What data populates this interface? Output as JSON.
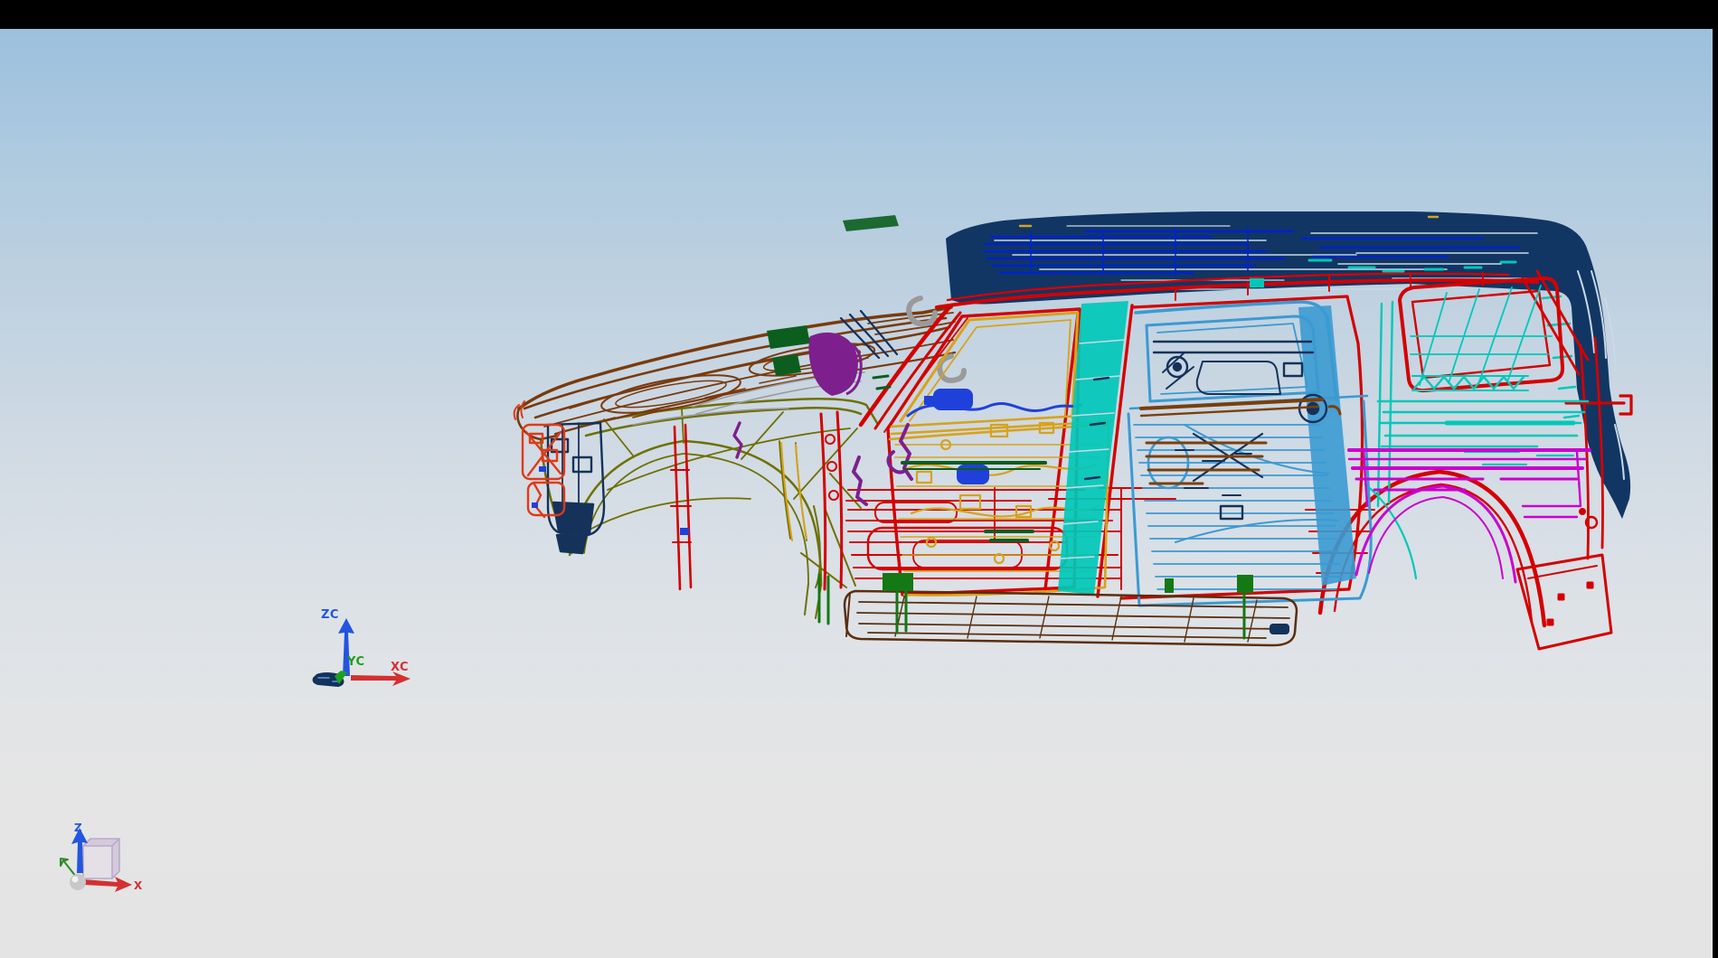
{
  "app": {
    "kind": "cad-viewport",
    "description": "CAD wireframe viewport showing an SUV body-in-white, side view"
  },
  "chrome": {
    "top_bar_color": "#000000",
    "right_bar_color": "#000000"
  },
  "viewport": {
    "gradient_top": "#9CC0DE",
    "gradient_mid": "#D5DDE5",
    "gradient_bottom": "#E4E4E4"
  },
  "wcs_triad": {
    "z_label": "ZC",
    "y_label": "YC",
    "x_label": "XC",
    "z_color": "#2255E0",
    "y_color": "#1F9E1F",
    "x_color": "#D43030"
  },
  "view_triad": {
    "z_label": "Z",
    "x_label": "X",
    "z_color": "#2255E0",
    "x_color": "#D43030",
    "y_color": "#2E8B2E",
    "cube_face_color": "#CEC2DA",
    "cube_edge_color": "#AC96C2",
    "ball_color": "#C8C8C8"
  },
  "parts": {
    "hood": {
      "label": "Hood",
      "color": "#7A3A0C"
    },
    "front_fender": {
      "label": "Front fender",
      "color": "#6E7000"
    },
    "front_bumper": {
      "label": "Front bumper bracket",
      "color": "#DF3A16"
    },
    "front_structure": {
      "label": "Front lower structure",
      "color": "#14325A"
    },
    "cowl_trim": {
      "label": "Cowl / mirror mount",
      "color": "#7E1F8E"
    },
    "body_frame": {
      "label": "Body side frame",
      "color": "#D40000"
    },
    "roof": {
      "label": "Roof / D-pillar",
      "color": "#113663"
    },
    "roof_lines": {
      "label": "Roof bow lines",
      "color": "#0022CC"
    },
    "roof_gaps": {
      "label": "Roof gap stripes",
      "color": "#C9D9E8"
    },
    "grab_handles": {
      "label": "Grab handles",
      "color": "#9A9A9A"
    },
    "front_door": {
      "label": "Front door",
      "color": "#D7A31A"
    },
    "door_hardware": {
      "label": "Door hardware",
      "color": "#1F41D9"
    },
    "door_hinges": {
      "label": "Door hinges / checks",
      "color": "#7E1F8E"
    },
    "b_pillar": {
      "label": "B-pillar",
      "color": "#00C8B9"
    },
    "rear_door": {
      "label": "Rear door",
      "color": "#3B9AD2"
    },
    "rear_internals": {
      "label": "Rear door internals",
      "color": "#14325A"
    },
    "door_beam": {
      "label": "Door belt beam",
      "color": "#7B3F08"
    },
    "rear_quarter": {
      "label": "Rear quarter panel",
      "color": "#00C8B9"
    },
    "arch_trim": {
      "label": "Rear wheel-arch trim",
      "color": "#CC00CC"
    },
    "rocker": {
      "label": "Rocker / running board",
      "color": "#5A2E0E"
    },
    "rocker_supports": {
      "label": "Rocker supports",
      "color": "#147814"
    },
    "accents_green": {
      "label": "Sealer bands",
      "color": "#0B5E1E"
    },
    "trim_gray": {
      "label": "Trim shadows",
      "color": "#9A9A9A"
    },
    "origin_part": {
      "label": "Bracket at origin",
      "color": "#14325A"
    }
  }
}
